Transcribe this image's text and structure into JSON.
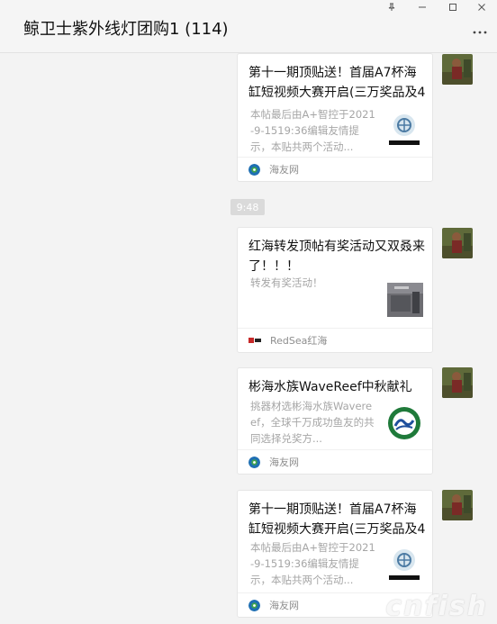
{
  "window": {
    "title": "鲸卫士紫外线灯团购1 (114)",
    "pin_icon": "⊥",
    "minimize_icon": "—",
    "maximize_icon": "□",
    "close_icon": "✕",
    "more_icon": "•••"
  },
  "timestamp": "9:48",
  "messages": [
    {
      "title": "第十一期顶贴送！首届A7杯海缸短视频大赛开启(三万奖品及40...",
      "desc": "本帖最后由A+智控于2021-9-1519:36编辑友情提示，本贴共两个活动...",
      "source": "海友网",
      "thumb_icon": "logo-a7-icon"
    },
    {
      "title": "红海转发顶帖有奖活动又双叒来了！！！",
      "desc": "转发有奖活动！",
      "source": "RedSea红海",
      "thumb_icon": "redsea-photo-icon"
    },
    {
      "title": "彬海水族WaveReef中秋献礼",
      "desc": "挑器材选彬海水族Wavereef，全球千万成功鱼友的共同选择兑奖方...",
      "source": "海友网",
      "thumb_icon": "wavereef-logo-icon"
    },
    {
      "title": "第十一期顶贴送！首届A7杯海缸短视频大赛开启(三万奖品及40...",
      "desc": "本帖最后由A+智控于2021-9-1519:36编辑友情提示，本贴共两个活动...",
      "source": "海友网",
      "thumb_icon": "logo-a7-icon"
    }
  ],
  "watermark": "cnfish",
  "colors": {
    "background": "#f3f3f3",
    "card": "#ffffff",
    "muted_text": "#a6a6a6"
  }
}
